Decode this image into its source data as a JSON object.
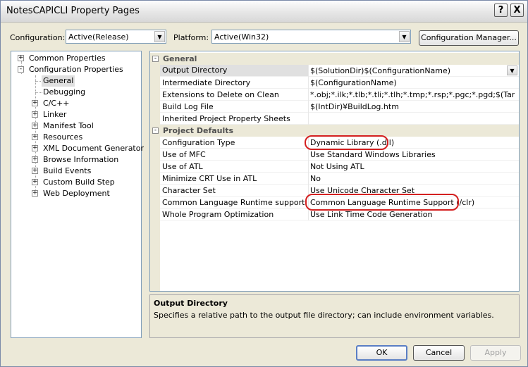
{
  "window": {
    "title": "NotesCAPICLI Property Pages",
    "help_label": "?",
    "close_label": "X"
  },
  "config_bar": {
    "configuration_label": "Configuration:",
    "configuration_value": "Active(Release)",
    "platform_label": "Platform:",
    "platform_value": "Active(Win32)",
    "manager_button": "Configuration Manager..."
  },
  "tree": {
    "items": [
      {
        "label": "Common Properties",
        "expander": "+"
      },
      {
        "label": "Configuration Properties",
        "expander": "-"
      },
      {
        "label": "General",
        "selected": true
      },
      {
        "label": "Debugging"
      },
      {
        "label": "C/C++",
        "expander": "+"
      },
      {
        "label": "Linker",
        "expander": "+"
      },
      {
        "label": "Manifest Tool",
        "expander": "+"
      },
      {
        "label": "Resources",
        "expander": "+"
      },
      {
        "label": "XML Document Generator",
        "expander": "+"
      },
      {
        "label": "Browse Information",
        "expander": "+"
      },
      {
        "label": "Build Events",
        "expander": "+"
      },
      {
        "label": "Custom Build Step",
        "expander": "+"
      },
      {
        "label": "Web Deployment",
        "expander": "+"
      }
    ]
  },
  "grid": {
    "categories": [
      {
        "title": "General",
        "expander": "-",
        "rows": [
          {
            "name": "Output Directory",
            "value": "$(SolutionDir)$(ConfigurationName)",
            "selected": true
          },
          {
            "name": "Intermediate Directory",
            "value": "$(ConfigurationName)"
          },
          {
            "name": "Extensions to Delete on Clean",
            "value": "*.obj;*.ilk;*.tlb;*.tli;*.tlh;*.tmp;*.rsp;*.pgc;*.pgd;$(TargetP"
          },
          {
            "name": "Build Log File",
            "value": "$(IntDir)¥BuildLog.htm"
          },
          {
            "name": "Inherited Project Property Sheets",
            "value": ""
          }
        ]
      },
      {
        "title": "Project Defaults",
        "expander": "-",
        "rows": [
          {
            "name": "Configuration Type",
            "value": "Dynamic Library (.dll)",
            "circled": true
          },
          {
            "name": "Use of MFC",
            "value": "Use Standard Windows Libraries"
          },
          {
            "name": "Use of ATL",
            "value": "Not Using ATL"
          },
          {
            "name": "Minimize CRT Use in ATL",
            "value": "No"
          },
          {
            "name": "Character Set",
            "value": "Use Unicode Character Set"
          },
          {
            "name": "Common Language Runtime support",
            "value": "Common Language Runtime Support (/clr)",
            "circled": true
          },
          {
            "name": "Whole Program Optimization",
            "value": "Use Link Time Code Generation"
          }
        ]
      }
    ],
    "annotation_color": "#d42020"
  },
  "description": {
    "title": "Output Directory",
    "text": "Specifies a relative path to the output file directory; can include environment variables."
  },
  "buttons": {
    "ok": "OK",
    "cancel": "Cancel",
    "apply": "Apply"
  },
  "icons": {
    "dropdown": "chevron-down-icon",
    "help": "help-icon",
    "close": "close-icon"
  }
}
